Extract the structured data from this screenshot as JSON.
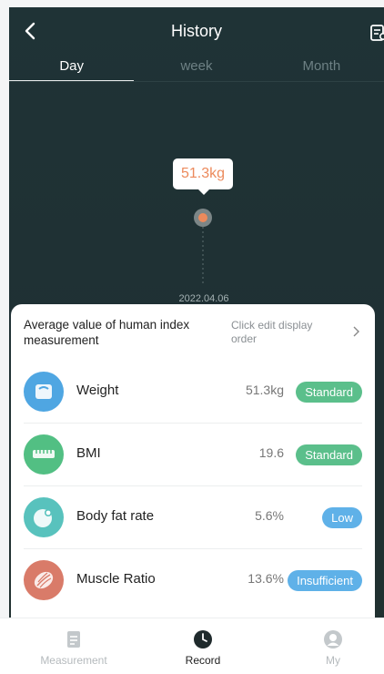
{
  "header": {
    "title": "History"
  },
  "tabs": [
    {
      "label": "Day",
      "active": true
    },
    {
      "label": "week",
      "active": false
    },
    {
      "label": "Month",
      "active": false
    }
  ],
  "chart_data": {
    "type": "scatter",
    "categories": [
      "2022.04.06"
    ],
    "values": [
      51.3
    ],
    "data_labels": [
      "51.3kg"
    ]
  },
  "card": {
    "title": "Average value of human index measurement",
    "edit_label": "Click edit display order",
    "rows": [
      {
        "name": "Weight",
        "value": "51.3kg",
        "status": "Standard",
        "status_color": "#5bbf8b",
        "icon": "scale-icon",
        "icon_color": "#4fa6e2"
      },
      {
        "name": "BMI",
        "value": "19.6",
        "status": "Standard",
        "status_color": "#5bbf8b",
        "icon": "ruler-icon",
        "icon_color": "#52bf83"
      },
      {
        "name": "Body fat rate",
        "value": "5.6%",
        "status": "Low",
        "status_color": "#5fb1e8",
        "icon": "fat-drop-icon",
        "icon_color": "#58c2bd"
      },
      {
        "name": "Muscle Ratio",
        "value": "13.6%",
        "status": "Insufficient",
        "status_color": "#5fb1e8",
        "icon": "muscle-icon",
        "icon_color": "#d97b69"
      }
    ]
  },
  "nav": [
    {
      "label": "Measurement",
      "icon": "document-icon",
      "active": false
    },
    {
      "label": "Record",
      "icon": "clock-icon",
      "active": true
    },
    {
      "label": "My",
      "icon": "user-icon",
      "active": false
    }
  ],
  "colors": {
    "accent": "#ec8a5c",
    "header_bg": "#1f3336"
  }
}
